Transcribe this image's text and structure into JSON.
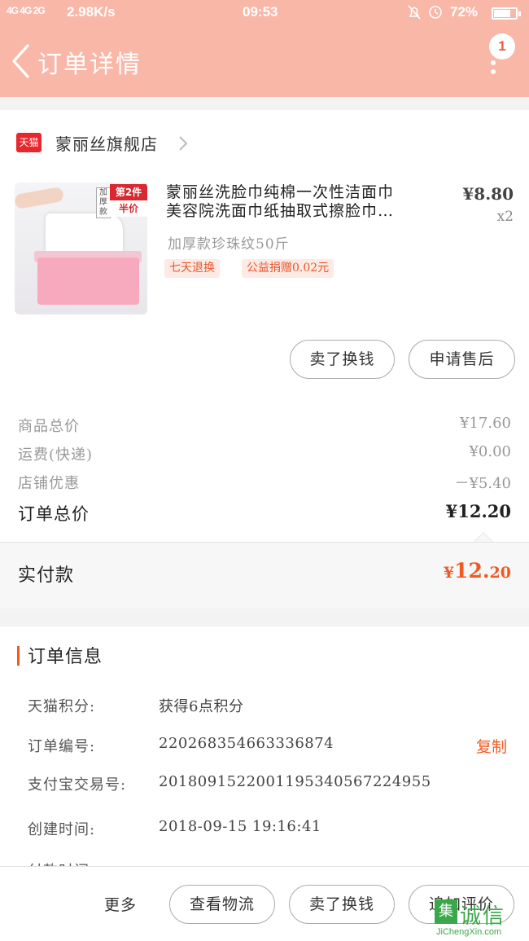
{
  "status_bar": {
    "signal": "4G 4G 2G",
    "speed": "2.98K/s",
    "time": "09:53",
    "battery": "72%",
    "battery_level": 0.72
  },
  "header": {
    "title": "订单详情",
    "badge_count": "1"
  },
  "shop": {
    "logo_text": "天猫",
    "name": "蒙丽丝旗舰店"
  },
  "product": {
    "image_tag_left": "加厚款",
    "image_tag_right_top": "第2件",
    "image_tag_right_bottom": "半价",
    "title_line1": "蒙丽丝洗脸巾纯棉一次性洁面巾",
    "title_line2": "美容院洗面巾纸抽取式擦脸巾…",
    "price": "¥8.80",
    "quantity": "x2",
    "sku": "加厚款珍珠纹50斤",
    "tags": [
      "七天退换",
      "公益捐赠0.02元"
    ]
  },
  "item_actions": {
    "sell_label": "卖了换钱",
    "aftersale_label": "申请售后"
  },
  "summary": {
    "rows": [
      {
        "label": "商品总价",
        "value": "¥17.60"
      },
      {
        "label": "运费(快递)",
        "value": "¥0.00"
      },
      {
        "label": "店铺优惠",
        "value": "－¥5.40"
      }
    ],
    "total_label": "订单总价",
    "total_value": "¥12.20",
    "paid_label": "实付款",
    "paid_symbol": "¥",
    "paid_int": "12.",
    "paid_dec": "20"
  },
  "order_info": {
    "heading": "订单信息",
    "rows": [
      {
        "key": "天猫积分:",
        "value": "获得6点积分"
      },
      {
        "key": "订单编号:",
        "value": "220268354663336874",
        "action": "复制"
      },
      {
        "key": "支付宝交易号:",
        "value": "2018091522001195340567224955"
      },
      {
        "key": "创建时间:",
        "value": "2018-09-15 19:16:41"
      }
    ],
    "partial_row_key": "付款时间"
  },
  "bottom_bar": {
    "more_label": "更多",
    "logistics_label": "查看物流",
    "sell_label": "卖了换钱",
    "review_label": "追加评价"
  },
  "watermark": {
    "mark": "集",
    "cn": "诚信",
    "en": "JiChengXin.com"
  },
  "colors": {
    "header_bg": "#f9b7a8",
    "accent": "#f05a24",
    "tmall_red": "#e8262d"
  },
  "icons": [
    "back-arrow-icon",
    "more-vertical-icon",
    "tmall-logo-icon",
    "chevron-right-icon",
    "bell-icon",
    "alarm-icon",
    "battery-icon"
  ]
}
